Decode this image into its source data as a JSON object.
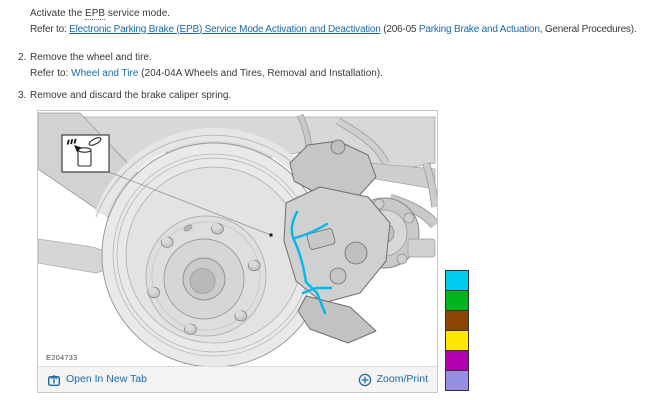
{
  "colors": {
    "link": "#1b6aad",
    "body_text": "#3a3a3a",
    "footer_bg": "#f4f4f4",
    "figure_border": "#c9c9c9",
    "highlight": "#00b9e8"
  },
  "steps": {
    "step1": {
      "text_pre": "Activate the ",
      "abbr": "EPB",
      "text_post": " service mode.",
      "refer_prefix": "Refer to: ",
      "refer_link": "Electronic Parking Brake (EPB) Service Mode Activation and Deactivation",
      "refer_mid": " (206-05 ",
      "refer_link2": "Parking Brake and Actuation",
      "refer_suffix": ", General Procedures)."
    },
    "step2": {
      "number": "2.",
      "text": "Remove the wheel and tire.",
      "refer_prefix": "Refer to: ",
      "refer_link": "Wheel and Tire",
      "refer_suffix": " (204-04A Wheels and Tires, Removal and Installation)."
    },
    "step3": {
      "number": "3.",
      "text": "Remove and discard the brake caliper spring."
    }
  },
  "figure": {
    "label": "E204733",
    "open_in_new_tab_label": "Open In New Tab",
    "zoom_print_label": "Zoom/Print",
    "highlight_color": "#00b9e8",
    "icons": {
      "callout": "discard-container-icon",
      "open_in_new_tab": "box-with-up-arrow-icon",
      "zoom_print": "circled-plus-icon"
    }
  },
  "palette": {
    "colors": [
      "#00cbee",
      "#00b41e",
      "#8a4500",
      "#ffe800",
      "#b200ae",
      "#9690e2"
    ]
  }
}
